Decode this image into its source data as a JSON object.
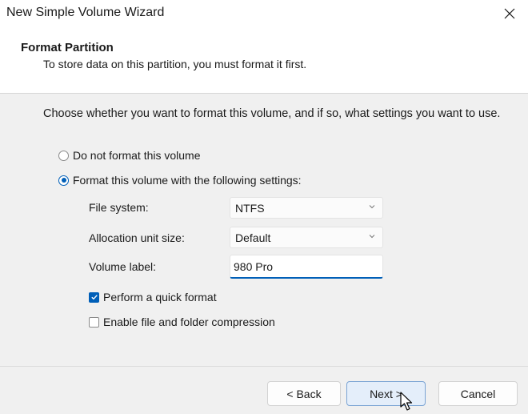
{
  "window": {
    "title": "New Simple Volume Wizard",
    "close_icon": "close-icon"
  },
  "header": {
    "title": "Format Partition",
    "subtitle": "To store data on this partition, you must format it first."
  },
  "body": {
    "instruction": "Choose whether you want to format this volume, and if so, what settings you want to use.",
    "options": [
      {
        "label": "Do not format this volume",
        "selected": false
      },
      {
        "label": "Format this volume with the following settings:",
        "selected": true
      }
    ],
    "fields": {
      "file_system": {
        "label": "File system:",
        "value": "NTFS"
      },
      "allocation_unit": {
        "label": "Allocation unit size:",
        "value": "Default"
      },
      "volume_label": {
        "label": "Volume label:",
        "value": "980 Pro"
      }
    },
    "checkboxes": [
      {
        "label": "Perform a quick format",
        "checked": true
      },
      {
        "label": "Enable file and folder compression",
        "checked": false
      }
    ]
  },
  "footer": {
    "back_label": "< Back",
    "next_label": "Next >",
    "cancel_label": "Cancel"
  },
  "colors": {
    "accent": "#005fb8",
    "background": "#f0f0f0",
    "header_bg": "#ffffff"
  }
}
